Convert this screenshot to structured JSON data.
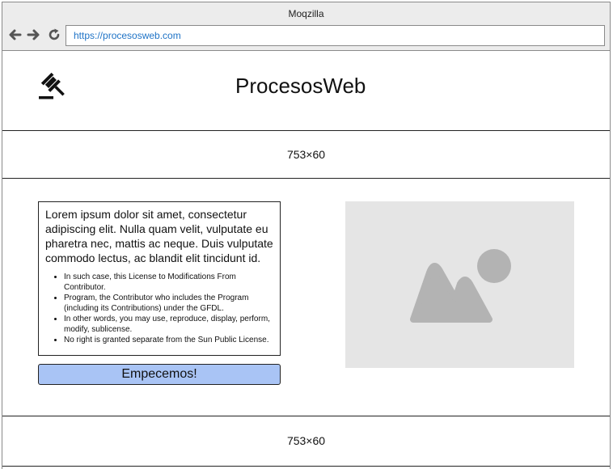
{
  "browser": {
    "title": "Moqzilla",
    "url": "https://procesosweb.com",
    "icons": [
      "arrow-left-icon",
      "arrow-right-icon",
      "reload-icon"
    ]
  },
  "header": {
    "logo_icon": "gavel-icon",
    "brand": "ProcesosWeb"
  },
  "banner": {
    "label": "753×60"
  },
  "content": {
    "paragraph": "Lorem ipsum dolor sit amet, consectetur adipiscing elit. Nulla quam velit, vulputate eu pharetra nec, mattis ac neque. Duis vulputate commodo lectus, ac blandit elit tincidunt id.",
    "bullets": [
      "In such case, this License to Modifications From Contributor.",
      "Program, the Contributor who includes the Program (including its Contributions) under the GFDL.",
      "In other words, you may use, reproduce, display, perform, modify, sublicense.",
      "No right is granted separate from the Sun Public License."
    ],
    "cta_label": "Empecemos!",
    "image_icon": "image-placeholder-icon"
  },
  "footer": {
    "label": "753×60"
  },
  "colors": {
    "url_text": "#1f73c6",
    "button_fill": "#a9c4f5",
    "placeholder_bg": "#e5e5e5",
    "placeholder_icon": "#b3b3b3"
  }
}
